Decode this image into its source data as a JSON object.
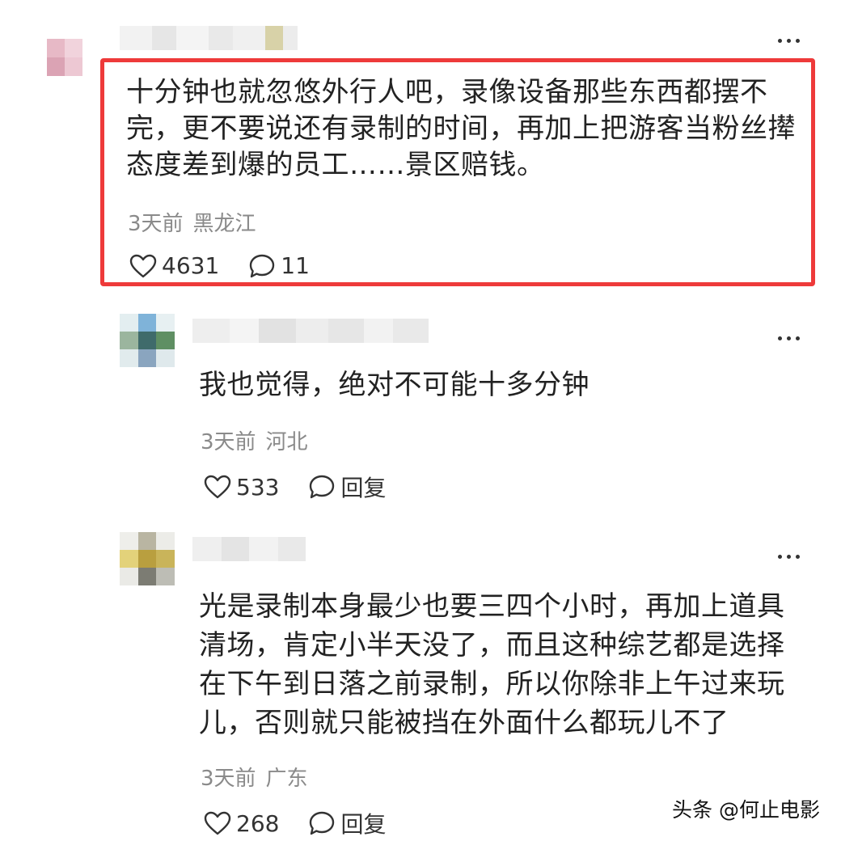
{
  "comments": [
    {
      "text": "十分钟也就忽悠外行人吧，录像设备那些东西都摆不\n完，更不要说还有录制的时间，再加上把游客当粉丝撵\n态度差到爆的员工……景区赔钱。",
      "time": "3天前",
      "location": "黑龙江",
      "likes": "4631",
      "replies": "11"
    },
    {
      "text": "我也觉得，绝对不可能十多分钟",
      "time": "3天前",
      "location": "河北",
      "likes": "533",
      "reply_label": "回复"
    },
    {
      "text": "光是录制本身最少也要三四个小时，再加上道具\n清场，肯定小半天没了，而且这种综艺都是选择\n在下午到日落之前录制，所以你除非上午过来玩\n儿，否则就只能被挡在外面什么都玩儿不了",
      "time": "3天前",
      "location": "广东",
      "likes": "268",
      "reply_label": "回复"
    }
  ],
  "watermark": "头条 @何止电影",
  "colors": {
    "highlight_border": "#ee3a3a",
    "meta_text": "#8a8a8a"
  },
  "icons": {
    "like": "heart-outline-icon",
    "comment": "speech-bubble-icon",
    "more": "more-dots-icon"
  }
}
